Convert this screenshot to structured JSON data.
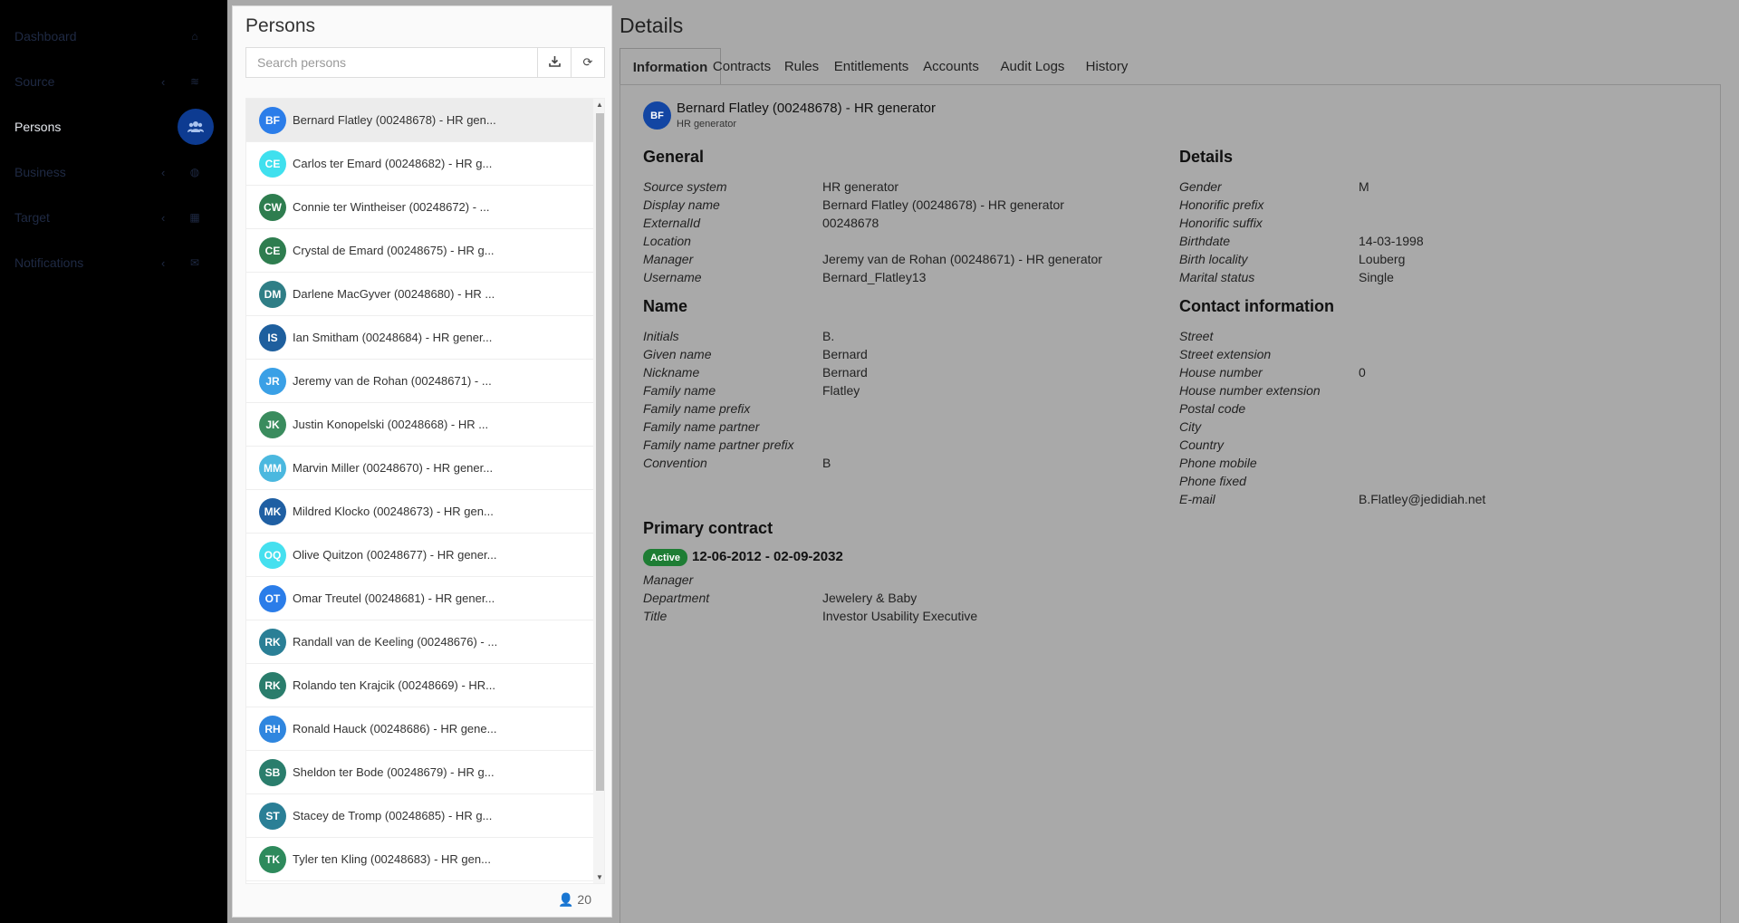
{
  "sidebar": {
    "items": [
      {
        "label": "Dashboard",
        "icon": "home-icon",
        "chevron": false,
        "active": false
      },
      {
        "label": "Source",
        "icon": "database-icon",
        "chevron": true,
        "active": false
      },
      {
        "label": "Persons",
        "icon": "users-icon",
        "chevron": false,
        "active": true
      },
      {
        "label": "Business",
        "icon": "globe-icon",
        "chevron": true,
        "active": false
      },
      {
        "label": "Target",
        "icon": "grid-icon",
        "chevron": true,
        "active": false
      },
      {
        "label": "Notifications",
        "icon": "envelope-icon",
        "chevron": true,
        "active": false
      }
    ]
  },
  "persons": {
    "title": "Persons",
    "search_placeholder": "Search persons",
    "count": "20",
    "items": [
      {
        "initials": "BF",
        "label": "Bernard Flatley (00248678) - HR gen...",
        "color": "#2b7de9",
        "selected": true
      },
      {
        "initials": "CE",
        "label": "Carlos ter Emard (00248682) - HR g...",
        "color": "#3fe0ee"
      },
      {
        "initials": "CW",
        "label": "Connie ter Wintheiser (00248672) - ...",
        "color": "#2e7d4f"
      },
      {
        "initials": "CE",
        "label": "Crystal de Emard (00248675) - HR g...",
        "color": "#2e7d4f"
      },
      {
        "initials": "DM",
        "label": "Darlene MacGyver (00248680) - HR ...",
        "color": "#2f7e86"
      },
      {
        "initials": "IS",
        "label": "Ian Smitham (00248684) - HR gener...",
        "color": "#1e5f9e"
      },
      {
        "initials": "JR",
        "label": "Jeremy van de Rohan (00248671) - ...",
        "color": "#3aa0e6"
      },
      {
        "initials": "JK",
        "label": "Justin Konopelski (00248668) - HR ...",
        "color": "#3a8c5e"
      },
      {
        "initials": "MM",
        "label": "Marvin Miller (00248670) - HR gener...",
        "color": "#4bb8df"
      },
      {
        "initials": "MK",
        "label": "Mildred Klocko (00248673) - HR gen...",
        "color": "#1f5fa3"
      },
      {
        "initials": "OQ",
        "label": "Olive Quitzon (00248677) - HR gener...",
        "color": "#45e0ef"
      },
      {
        "initials": "OT",
        "label": "Omar Treutel (00248681) - HR gener...",
        "color": "#2b7de9"
      },
      {
        "initials": "RK",
        "label": "Randall van de Keeling (00248676) - ...",
        "color": "#2a7f96"
      },
      {
        "initials": "RK",
        "label": "Rolando ten Krajcik (00248669) - HR...",
        "color": "#2a7d6c"
      },
      {
        "initials": "RH",
        "label": "Ronald Hauck (00248686) - HR gene...",
        "color": "#2f86df"
      },
      {
        "initials": "SB",
        "label": "Sheldon ter Bode (00248679) - HR g...",
        "color": "#2a7d6c"
      },
      {
        "initials": "ST",
        "label": "Stacey de Tromp (00248685) - HR g...",
        "color": "#2a7f96"
      },
      {
        "initials": "TK",
        "label": "Tyler ten Kling (00248683) - HR gen...",
        "color": "#2e8a5c"
      }
    ]
  },
  "details": {
    "title": "Details",
    "tabs": [
      "Information",
      "Contracts",
      "Rules",
      "Entitlements",
      "Accounts",
      "Audit Logs",
      "History"
    ],
    "active_tab": "Information",
    "header": {
      "initials": "BF",
      "name": "Bernard Flatley (00248678) - HR generator",
      "sub": "HR generator"
    },
    "general": {
      "title": "General",
      "fields": [
        {
          "label": "Source system",
          "value": "HR generator"
        },
        {
          "label": "Display name",
          "value": "Bernard Flatley (00248678) - HR generator"
        },
        {
          "label": "ExternalId",
          "value": "00248678"
        },
        {
          "label": "Location",
          "value": ""
        },
        {
          "label": "Manager",
          "value": "Jeremy van de Rohan (00248671) - HR generator"
        },
        {
          "label": "Username",
          "value": "Bernard_Flatley13"
        }
      ]
    },
    "name": {
      "title": "Name",
      "fields": [
        {
          "label": "Initials",
          "value": "B."
        },
        {
          "label": "Given name",
          "value": "Bernard"
        },
        {
          "label": "Nickname",
          "value": "Bernard"
        },
        {
          "label": "Family name",
          "value": "Flatley"
        },
        {
          "label": "Family name prefix",
          "value": ""
        },
        {
          "label": "Family name partner",
          "value": ""
        },
        {
          "label": "Family name partner prefix",
          "value": ""
        },
        {
          "label": "Convention",
          "value": "B"
        }
      ]
    },
    "details_section": {
      "title": "Details",
      "fields": [
        {
          "label": "Gender",
          "value": "M"
        },
        {
          "label": "Honorific prefix",
          "value": ""
        },
        {
          "label": "Honorific suffix",
          "value": ""
        },
        {
          "label": "Birthdate",
          "value": "14-03-1998"
        },
        {
          "label": "Birth locality",
          "value": "Louberg"
        },
        {
          "label": "Marital status",
          "value": "Single"
        }
      ]
    },
    "contact": {
      "title": "Contact information",
      "fields": [
        {
          "label": "Street",
          "value": ""
        },
        {
          "label": "Street extension",
          "value": ""
        },
        {
          "label": "House number",
          "value": "0"
        },
        {
          "label": "House number extension",
          "value": ""
        },
        {
          "label": "Postal code",
          "value": ""
        },
        {
          "label": "City",
          "value": ""
        },
        {
          "label": "Country",
          "value": ""
        },
        {
          "label": "Phone mobile",
          "value": ""
        },
        {
          "label": "Phone fixed",
          "value": ""
        },
        {
          "label": "E-mail",
          "value": "B.Flatley@jedidiah.net"
        }
      ]
    },
    "primary_contract": {
      "title": "Primary contract",
      "status": "Active",
      "status_color": "#1e7d34",
      "date_range": "12-06-2012 - 02-09-2032",
      "fields": [
        {
          "label": "Manager",
          "value": ""
        },
        {
          "label": "Department",
          "value": "Jewelery & Baby"
        },
        {
          "label": "Title",
          "value": "Investor Usability Executive"
        }
      ]
    }
  }
}
